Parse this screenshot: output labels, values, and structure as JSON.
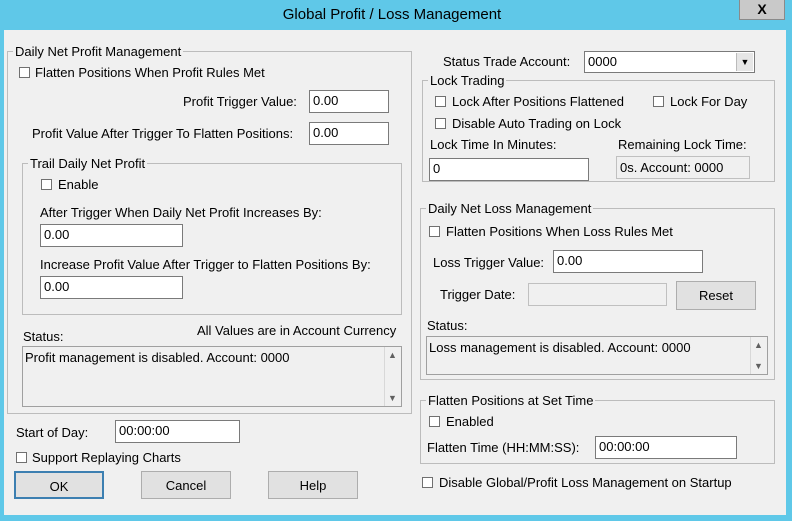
{
  "window": {
    "title": "Global Profit / Loss Management",
    "close_glyph": "X"
  },
  "profit": {
    "group_title": "Daily Net Profit Management",
    "flatten_label": "Flatten Positions When Profit Rules Met",
    "trigger_label": "Profit Trigger Value:",
    "trigger_value": "0.00",
    "after_label": "Profit Value After Trigger To Flatten Positions:",
    "after_value": "0.00",
    "trail": {
      "group_title": "Trail Daily Net Profit",
      "enable_label": "Enable",
      "increase_label": "After Trigger When Daily Net Profit Increases By:",
      "increase_value": "0.00",
      "increase_flatten_label": "Increase Profit Value After Trigger to Flatten Positions By:",
      "increase_flatten_value": "0.00"
    },
    "status_label": "Status:",
    "currency_note": "All Values are in Account Currency",
    "status_text": "Profit management is disabled. Account: 0000"
  },
  "status_account": {
    "label": "Status Trade Account:",
    "value": "0000"
  },
  "lock": {
    "group_title": "Lock Trading",
    "after_flatten_label": "Lock After Positions Flattened",
    "for_day_label": "Lock For Day",
    "disable_auto_label": "Disable Auto Trading on Lock",
    "minutes_label": "Lock Time In Minutes:",
    "minutes_value": "0",
    "remaining_label": "Remaining Lock Time:",
    "remaining_value": "0s. Account: 0000"
  },
  "loss": {
    "group_title": "Daily Net Loss Management",
    "flatten_label": "Flatten Positions When Loss Rules Met",
    "trigger_label": "Loss Trigger Value:",
    "trigger_value": "0.00",
    "date_label": "Trigger Date:",
    "date_value": "",
    "reset_label": "Reset",
    "status_label": "Status:",
    "status_text": "Loss management is disabled. Account: 0000"
  },
  "flatten_time": {
    "group_title": "Flatten Positions at Set Time",
    "enabled_label": "Enabled",
    "time_label": "Flatten Time (HH:MM:SS):",
    "time_value": "00:00:00"
  },
  "start_of_day": {
    "label": "Start of Day:",
    "value": "00:00:00"
  },
  "support_replay_label": "Support Replaying Charts",
  "disable_startup_label": "Disable Global/Profit Loss Management on Startup",
  "buttons": {
    "ok": "OK",
    "cancel": "Cancel",
    "help": "Help"
  }
}
